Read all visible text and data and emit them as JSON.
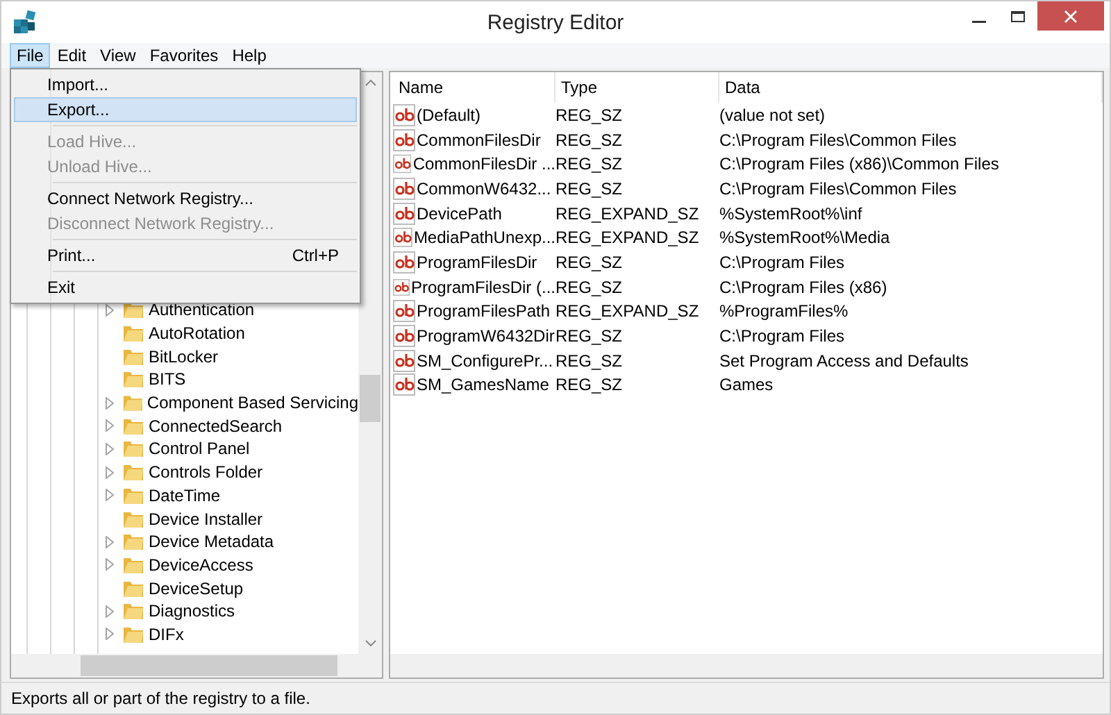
{
  "window": {
    "title": "Registry Editor"
  },
  "menu_bar": [
    {
      "label": "File",
      "selected": true
    },
    {
      "label": "Edit",
      "selected": false
    },
    {
      "label": "View",
      "selected": false
    },
    {
      "label": "Favorites",
      "selected": false
    },
    {
      "label": "Help",
      "selected": false
    }
  ],
  "file_menu": [
    {
      "kind": "item",
      "label": "Import...",
      "disabled": false,
      "selected": false
    },
    {
      "kind": "item",
      "label": "Export...",
      "disabled": false,
      "selected": true
    },
    {
      "kind": "separator"
    },
    {
      "kind": "item",
      "label": "Load Hive...",
      "disabled": true,
      "selected": false
    },
    {
      "kind": "item",
      "label": "Unload Hive...",
      "disabled": true,
      "selected": false
    },
    {
      "kind": "separator"
    },
    {
      "kind": "item",
      "label": "Connect Network Registry...",
      "disabled": false,
      "selected": false
    },
    {
      "kind": "item",
      "label": "Disconnect Network Registry...",
      "disabled": true,
      "selected": false
    },
    {
      "kind": "separator"
    },
    {
      "kind": "item",
      "label": "Print...",
      "shortcut": "Ctrl+P",
      "disabled": false,
      "selected": false
    },
    {
      "kind": "separator"
    },
    {
      "kind": "item",
      "label": "Exit",
      "disabled": false,
      "selected": false
    }
  ],
  "tree": [
    {
      "label": "Authentication",
      "expandable": true
    },
    {
      "label": "AutoRotation",
      "expandable": false
    },
    {
      "label": "BitLocker",
      "expandable": false
    },
    {
      "label": "BITS",
      "expandable": false
    },
    {
      "label": "Component Based Servicing",
      "expandable": true
    },
    {
      "label": "ConnectedSearch",
      "expandable": true
    },
    {
      "label": "Control Panel",
      "expandable": true
    },
    {
      "label": "Controls Folder",
      "expandable": true
    },
    {
      "label": "DateTime",
      "expandable": true
    },
    {
      "label": "Device Installer",
      "expandable": false
    },
    {
      "label": "Device Metadata",
      "expandable": true
    },
    {
      "label": "DeviceAccess",
      "expandable": true
    },
    {
      "label": "DeviceSetup",
      "expandable": false
    },
    {
      "label": "Diagnostics",
      "expandable": true
    },
    {
      "label": "DIFx",
      "expandable": true
    }
  ],
  "table": {
    "columns": [
      "Name",
      "Type",
      "Data"
    ],
    "rows": [
      [
        "(Default)",
        "REG_SZ",
        "(value not set)"
      ],
      [
        "CommonFilesDir",
        "REG_SZ",
        "C:\\Program Files\\Common Files"
      ],
      [
        "CommonFilesDir ...",
        "REG_SZ",
        "C:\\Program Files (x86)\\Common Files"
      ],
      [
        "CommonW6432...",
        "REG_SZ",
        "C:\\Program Files\\Common Files"
      ],
      [
        "DevicePath",
        "REG_EXPAND_SZ",
        "%SystemRoot%\\inf"
      ],
      [
        "MediaPathUnexp...",
        "REG_EXPAND_SZ",
        "%SystemRoot%\\Media"
      ],
      [
        "ProgramFilesDir",
        "REG_SZ",
        "C:\\Program Files"
      ],
      [
        "ProgramFilesDir (...",
        "REG_SZ",
        "C:\\Program Files (x86)"
      ],
      [
        "ProgramFilesPath",
        "REG_EXPAND_SZ",
        "%ProgramFiles%"
      ],
      [
        "ProgramW6432Dir",
        "REG_SZ",
        "C:\\Program Files"
      ],
      [
        "SM_ConfigurePr...",
        "REG_SZ",
        "Set Program Access and Defaults"
      ],
      [
        "SM_GamesName",
        "REG_SZ",
        "Games"
      ]
    ]
  },
  "status_bar": "Exports all or part of the registry to a file."
}
